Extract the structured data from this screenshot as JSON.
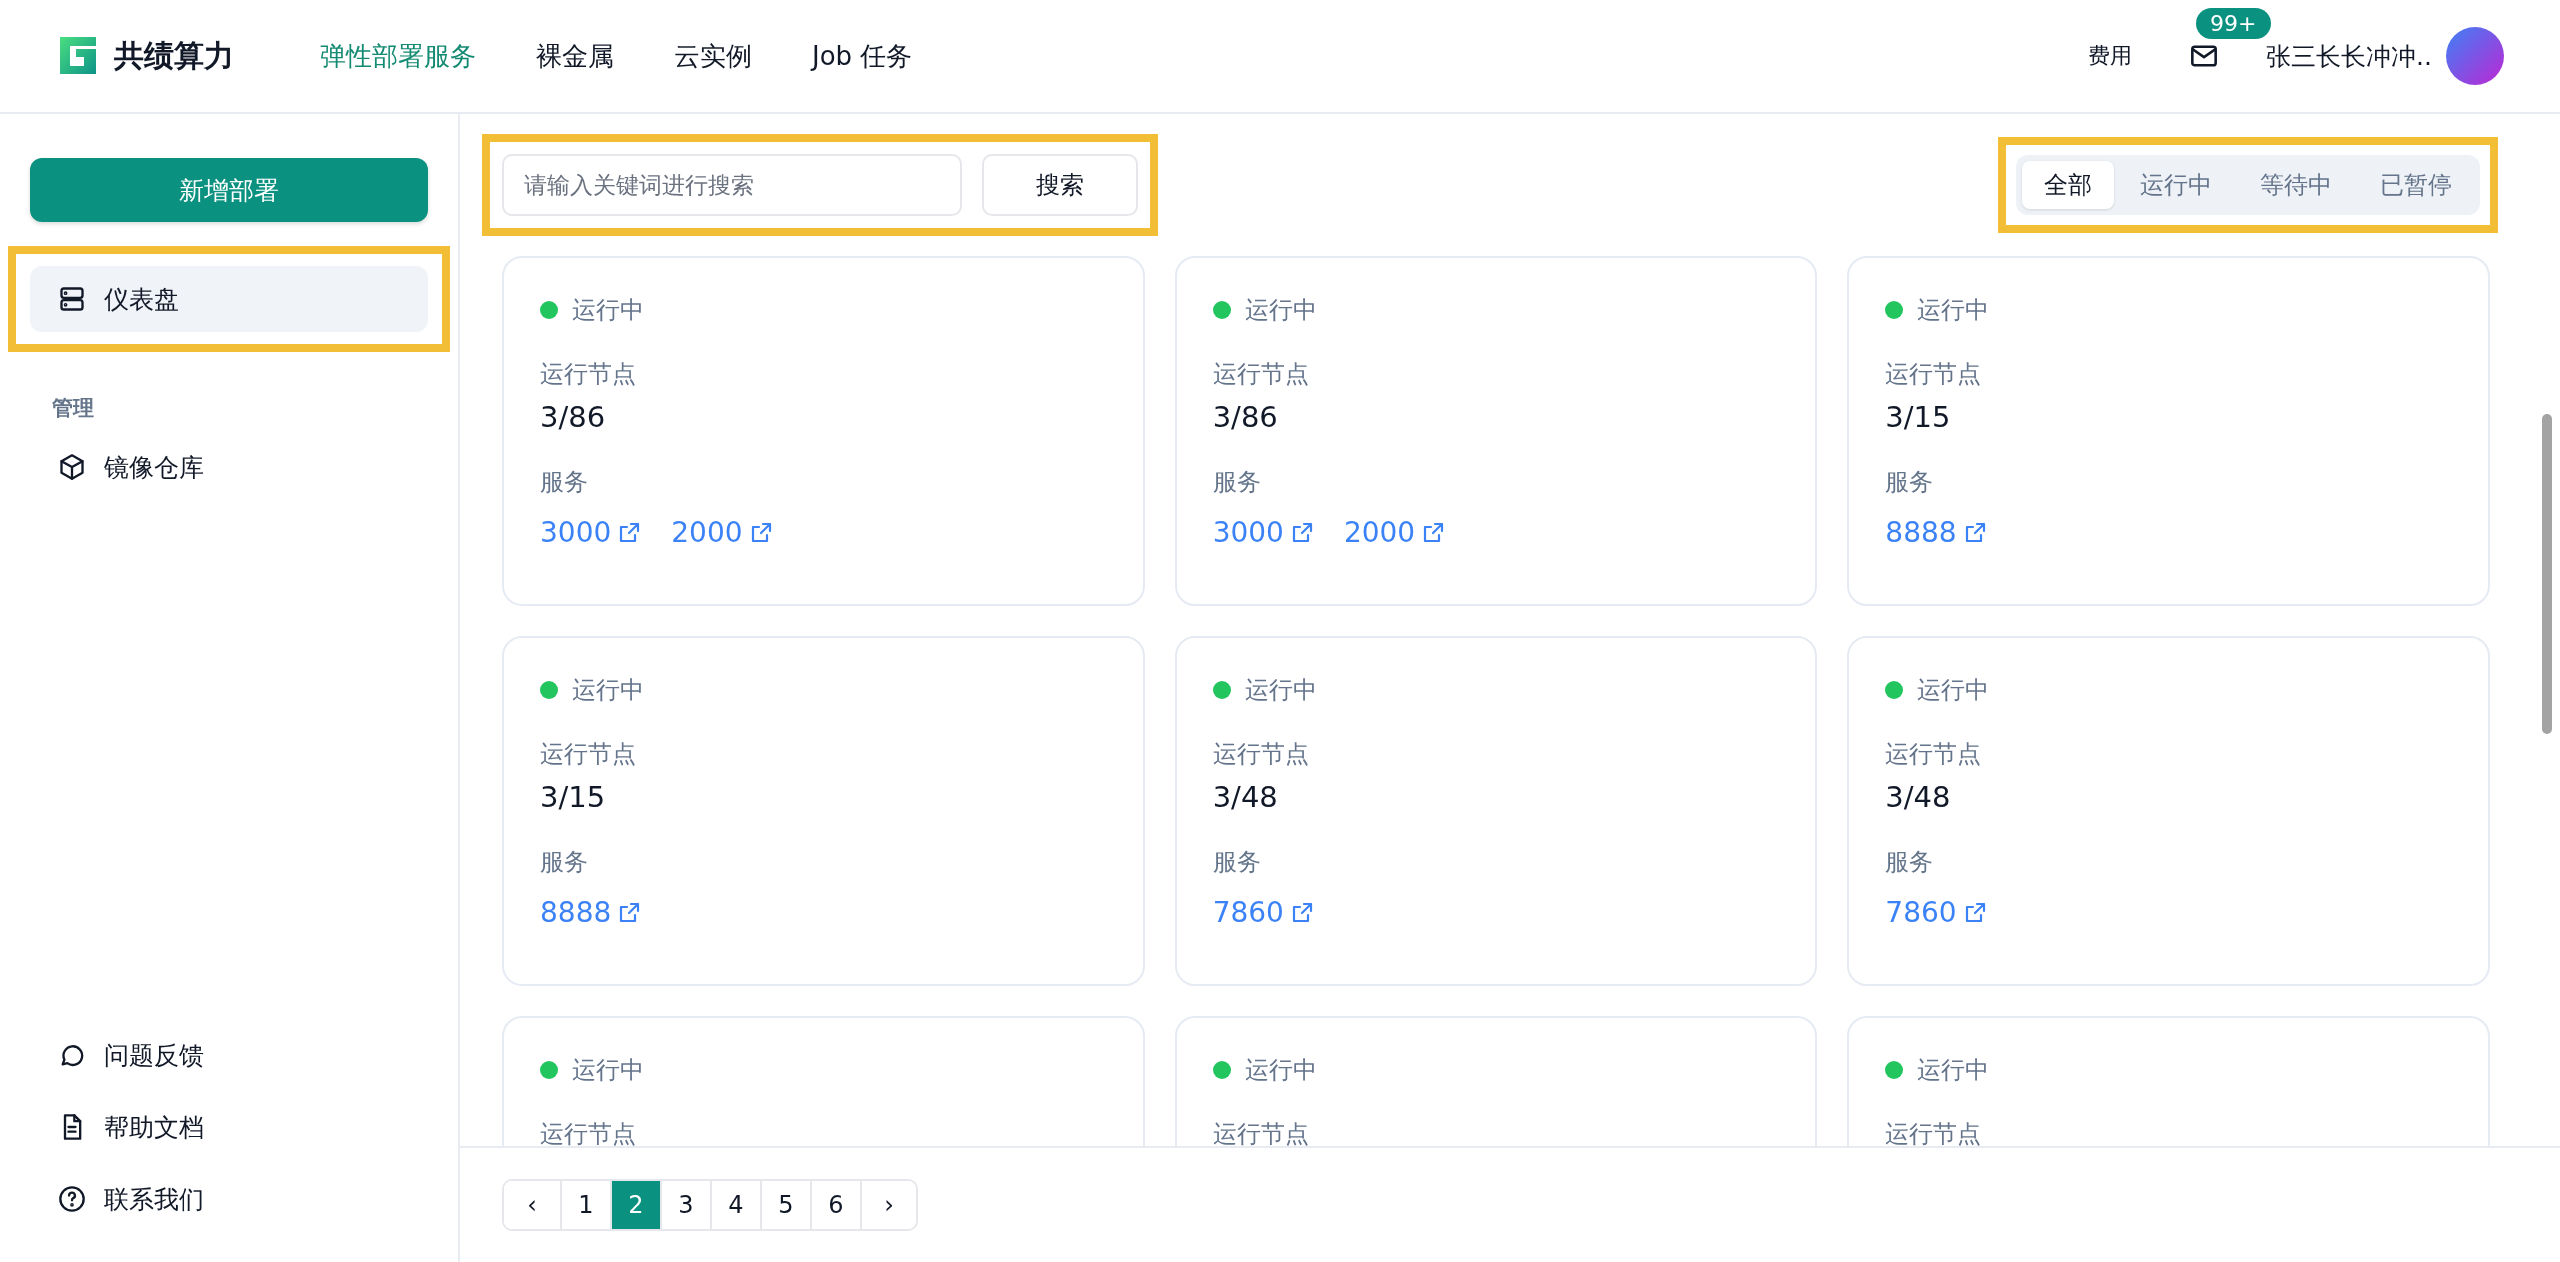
{
  "header": {
    "brand": "共绩算力",
    "nav": [
      {
        "label": "弹性部署服务",
        "selected": true
      },
      {
        "label": "裸金属",
        "selected": false
      },
      {
        "label": "云实例",
        "selected": false
      },
      {
        "label": "Job 任务",
        "selected": false
      }
    ],
    "billing": "费用",
    "badge": "99+",
    "user": "张三长长冲冲.."
  },
  "sidebar": {
    "new_button": "新增部署",
    "items": [
      {
        "label": "仪表盘",
        "selected": true
      }
    ],
    "section": "管理",
    "section_items": [
      {
        "label": "镜像仓库",
        "selected": false
      }
    ],
    "bottom_items": [
      {
        "label": "问题反馈"
      },
      {
        "label": "帮助文档"
      },
      {
        "label": "联系我们"
      }
    ]
  },
  "search": {
    "placeholder": "请输入关键词进行搜索",
    "button": "搜索"
  },
  "filters": [
    {
      "label": "全部",
      "selected": true
    },
    {
      "label": "运行中",
      "selected": false
    },
    {
      "label": "等待中",
      "selected": false
    },
    {
      "label": "已暂停",
      "selected": false
    }
  ],
  "cards": [
    {
      "status": "运行中",
      "color": "#22c55e",
      "nodes_label": "运行节点",
      "nodes": "3/86",
      "services_label": "服务",
      "services": [
        "3000",
        "2000"
      ]
    },
    {
      "status": "运行中",
      "color": "#22c55e",
      "nodes_label": "运行节点",
      "nodes": "3/86",
      "services_label": "服务",
      "services": [
        "3000",
        "2000"
      ]
    },
    {
      "status": "运行中",
      "color": "#22c55e",
      "nodes_label": "运行节点",
      "nodes": "3/15",
      "services_label": "服务",
      "services": [
        "8888"
      ]
    },
    {
      "status": "运行中",
      "color": "#22c55e",
      "nodes_label": "运行节点",
      "nodes": "3/15",
      "services_label": "服务",
      "services": [
        "8888"
      ]
    },
    {
      "status": "运行中",
      "color": "#22c55e",
      "nodes_label": "运行节点",
      "nodes": "3/48",
      "services_label": "服务",
      "services": [
        "7860"
      ]
    },
    {
      "status": "运行中",
      "color": "#22c55e",
      "nodes_label": "运行节点",
      "nodes": "3/48",
      "services_label": "服务",
      "services": [
        "7860"
      ]
    },
    {
      "status": "运行中",
      "color": "#22c55e",
      "nodes_label": "运行节点"
    },
    {
      "status": "运行中",
      "color": "#22c55e",
      "nodes_label": "运行节点"
    },
    {
      "status": "运行中",
      "color": "#22c55e",
      "nodes_label": "运行节点"
    }
  ],
  "pagination": {
    "prev": "‹",
    "next": "›",
    "pages": [
      {
        "label": "1",
        "selected": false
      },
      {
        "label": "2",
        "selected": true
      },
      {
        "label": "3",
        "selected": false
      },
      {
        "label": "4",
        "selected": false
      },
      {
        "label": "5",
        "selected": false
      },
      {
        "label": "6",
        "selected": false
      }
    ]
  }
}
